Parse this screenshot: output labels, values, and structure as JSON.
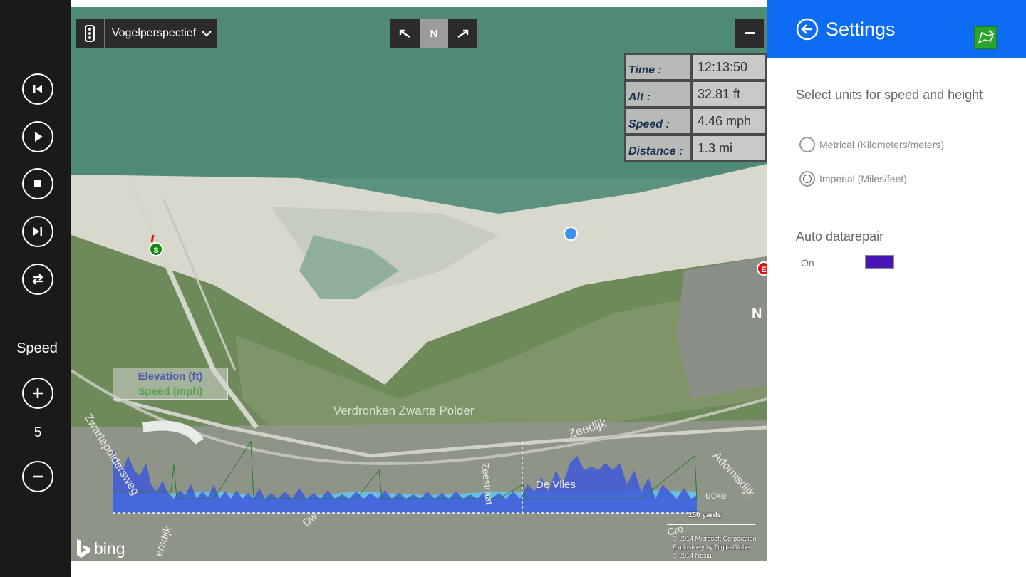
{
  "rail": {
    "buttons": [
      {
        "name": "previous-track-button",
        "icon": "skip-back-icon"
      },
      {
        "name": "play-button",
        "icon": "play-icon"
      },
      {
        "name": "stop-button",
        "icon": "stop-icon"
      },
      {
        "name": "next-track-button",
        "icon": "skip-forward-icon"
      },
      {
        "name": "swap-button",
        "icon": "swap-arrows-icon"
      }
    ],
    "speed_label": "Speed",
    "speed_value": "5",
    "speed_increase_icon": "plus-circle-icon",
    "speed_decrease_icon": "minus-circle-icon"
  },
  "map": {
    "view_mode": "Vogelperspectief",
    "compass_north": "N",
    "stats": [
      {
        "key": "Time :",
        "value": "12:13:50"
      },
      {
        "key": "Alt :",
        "value": "32.81 ft"
      },
      {
        "key": "Speed :",
        "value": "4.46 mph"
      },
      {
        "key": "Distance :",
        "value": "1.3 mi"
      }
    ],
    "legend": {
      "elevation": "Elevation (ft)",
      "speed": "Speed (mph)"
    },
    "place_labels": {
      "polder": "Verdronken Zwarte Polder",
      "zeedijk": "Zeedijk",
      "zwartepoldersweg": "Zwartepoldersweg",
      "adornisdijk": "Adornisdijk",
      "de_vlies": "De Vlies",
      "duinweg": "Dw",
      "straat": "Zeestraat",
      "dijk": "ersdijk",
      "n_label": "N",
      "cro": "Cro",
      "ucke": "ucke"
    },
    "start_marker": "S",
    "end_marker": "E",
    "scale": "150 yards",
    "copyright": [
      "© 2014 Microsoft Corporation",
      "Exclusively by DigitalGlobe",
      "© 2014 Nokia"
    ],
    "bing_logo": "bing",
    "colors": {
      "track": "#ee1111",
      "position": "#3d8ff0",
      "elevation": "#4058d8",
      "speed_area": "#62c8f0"
    }
  },
  "settings": {
    "title": "Settings",
    "back_icon": "back-arrow-icon",
    "app_icon": "app-logo-icon",
    "units_title": "Select units for speed and height",
    "metric_label": "Metrical (Kilometers/meters)",
    "imperial_label": "Imperial (Miles/feet)",
    "selected_unit": "imperial",
    "datarepair_title": "Auto datarepair",
    "datarepair_state": "On",
    "accent": "#0d6cf4"
  }
}
